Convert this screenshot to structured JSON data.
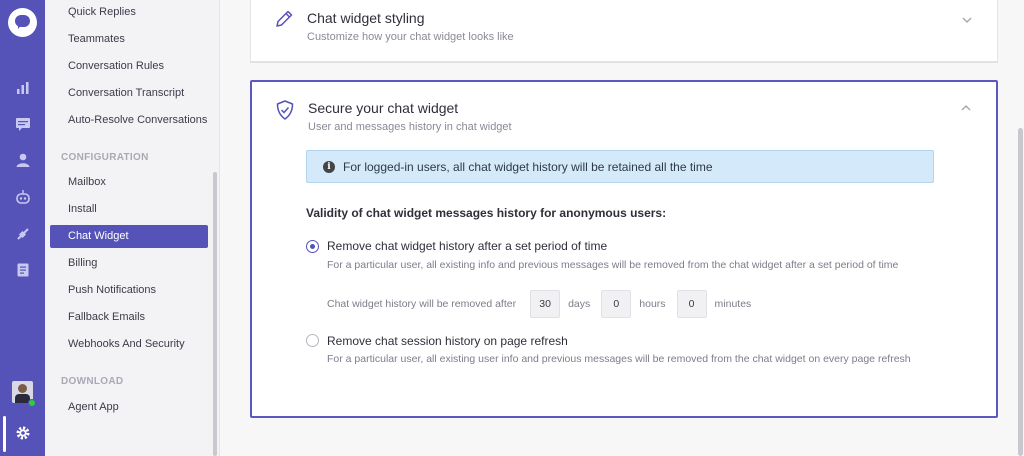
{
  "sidebar": {
    "items_top": [
      "Quick Replies",
      "Teammates",
      "Conversation Rules",
      "Conversation Transcript",
      "Auto-Resolve Conversations"
    ],
    "config_label": "CONFIGURATION",
    "config_items": [
      "Mailbox",
      "Install",
      "Chat Widget",
      "Billing",
      "Push Notifications",
      "Fallback Emails",
      "Webhooks And Security"
    ],
    "download_label": "DOWNLOAD",
    "download_items": [
      "Agent App"
    ],
    "active": "Chat Widget"
  },
  "rail_icons": [
    "logo-icon",
    "reports-icon",
    "conversations-icon",
    "contacts-icon",
    "bot-icon",
    "integrations-icon",
    "knowledge-base-icon",
    "avatar",
    "settings-icon"
  ],
  "styling_card": {
    "title": "Chat widget styling",
    "subtitle": "Customize how your chat widget looks like"
  },
  "secure_card": {
    "title": "Secure your chat widget",
    "subtitle": "User and messages history in chat widget",
    "info": "For logged-in users, all chat widget history will be retained all the time",
    "validity_label": "Validity of chat widget messages history for anonymous users:",
    "option1": {
      "title": "Remove chat widget history after a set period of time",
      "desc": "For a particular user, all existing info and previous messages will be removed from the chat widget after a set period of time",
      "selected": true
    },
    "period": {
      "lead": "Chat widget history will be removed after",
      "days": "30",
      "days_label": "days",
      "hours": "0",
      "hours_label": "hours",
      "minutes": "0",
      "minutes_label": "minutes"
    },
    "option2": {
      "title": "Remove chat session history on page refresh",
      "desc": "For a particular user, all existing user info and previous messages will be removed from the chat widget on every page refresh",
      "selected": false
    }
  },
  "colors": {
    "accent": "#5553b7",
    "info_bg": "#d4e9f9"
  }
}
